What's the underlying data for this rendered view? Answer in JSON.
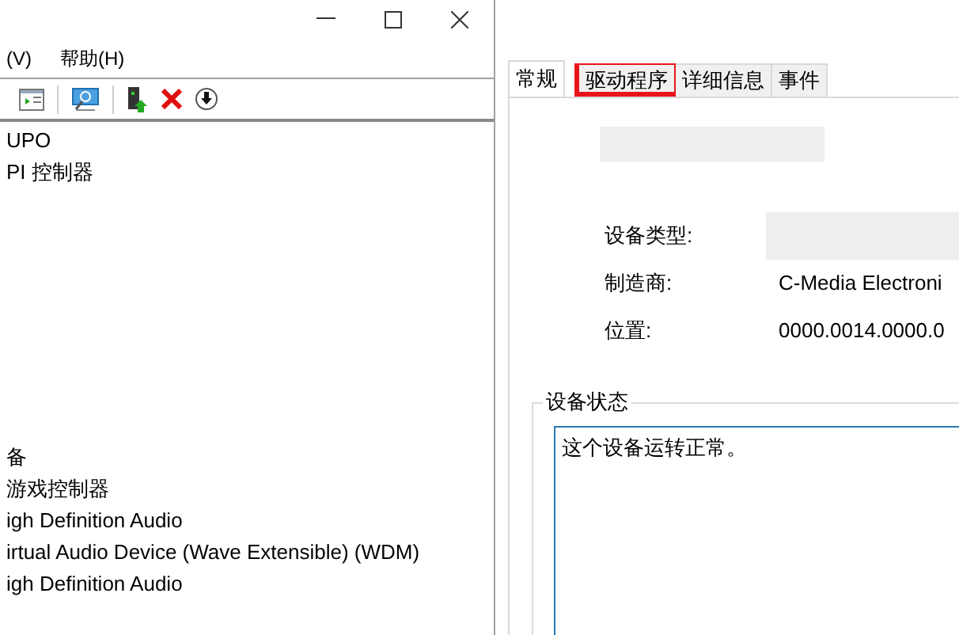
{
  "menu": [
    {
      "label": "(V)"
    },
    {
      "label": "帮助(H)"
    }
  ],
  "tree_top": [
    {
      "label": "UPO"
    },
    {
      "label": "PI 控制器"
    }
  ],
  "tree_bottom": [
    {
      "label": "备"
    },
    {
      "label": "游戏控制器"
    },
    {
      "label": "igh Definition Audio"
    },
    {
      "label": "irtual Audio Device (Wave Extensible) (WDM)"
    },
    {
      "label": "igh Definition Audio"
    }
  ],
  "tabs": [
    {
      "label": "常规",
      "selected": true,
      "highlighted": false
    },
    {
      "label": "驱动程序",
      "selected": false,
      "highlighted": true
    },
    {
      "label": "详细信息",
      "selected": false,
      "highlighted": false
    },
    {
      "label": "事件",
      "selected": false,
      "highlighted": false
    }
  ],
  "properties": [
    {
      "label": "设备类型:",
      "kind": "redacted"
    },
    {
      "label": "制造商:",
      "kind": "text",
      "value": "C-Media Electroni"
    },
    {
      "label": "位置:",
      "kind": "text",
      "value": "0000.0014.0000.0"
    }
  ],
  "status_group": {
    "title": "设备状态",
    "text": "这个设备运转正常。"
  }
}
